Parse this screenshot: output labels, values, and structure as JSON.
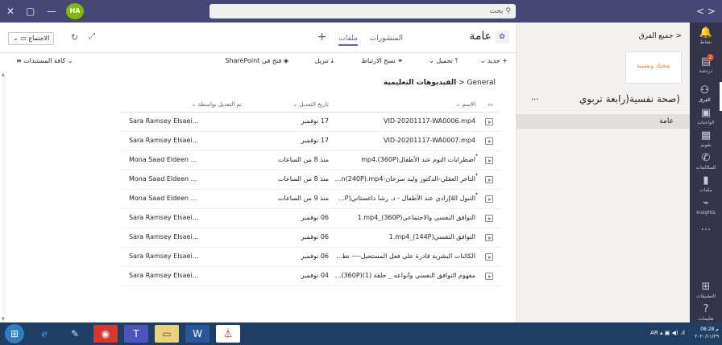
{
  "titlebar": {
    "avatar_initials": "HA",
    "search_placeholder": "بحث"
  },
  "appbar": {
    "items": [
      {
        "label": "نشاط",
        "icon": "bell-icon"
      },
      {
        "label": "دردشة",
        "icon": "chat-icon",
        "badge": "2"
      },
      {
        "label": "الفرق",
        "icon": "teams-icon"
      },
      {
        "label": "الواجبات",
        "icon": "assignments-icon"
      },
      {
        "label": "تقويم",
        "icon": "calendar-icon"
      },
      {
        "label": "المكالمات",
        "icon": "phone-icon"
      },
      {
        "label": "ملفات",
        "icon": "files-icon"
      },
      {
        "label": "Insights",
        "icon": "insights-icon"
      },
      {
        "label": "...",
        "icon": "more-icon"
      },
      {
        "label": "التطبيقات",
        "icon": "apps-icon"
      },
      {
        "label": "تعليمات",
        "icon": "help-icon"
      }
    ]
  },
  "teampanel": {
    "back_label": "جميع الفرق",
    "team_name": "(صحة نفسية(رابعة تربوي",
    "more": "...",
    "logo_text": "صحتك ونفسية",
    "channel": "عامة"
  },
  "channel_header": {
    "name": "عامة",
    "tabs": [
      "المنشورات",
      "ملفات"
    ],
    "active_tab": 1,
    "add_tab": "+",
    "meet_label": "الاجتماع"
  },
  "commandbar": {
    "new": "جديد",
    "upload": "تحميل",
    "copy_link": "نسخ الارتباط",
    "download": "تنزيل",
    "open_sharepoint": "فتح في SharePoint",
    "view": "كافة المستندات"
  },
  "breadcrumb": {
    "root": "General",
    "current": "الفيديوهات التعليمية"
  },
  "table": {
    "headers": {
      "name": "الاسم",
      "modified": "تاريخ التعديل",
      "modified_by": "تم التعديل بواسطة"
    },
    "rows": [
      {
        "name": "VID-20201117-WA0006.mp4",
        "modified": "17 نوفمبر",
        "by": "Sara Ramsey Elsaei...",
        "new": false
      },
      {
        "name": "VID-20201117-WA0007.mp4",
        "modified": "17 نوفمبر",
        "by": "Sara Ramsey Elsaei...",
        "new": false
      },
      {
        "name": "اضطرابات النوم عند الأطفال(360P).mp4",
        "modified": "منذ 8 من الساعات",
        "by": "Mona Saad Eldeen ...",
        "new": true
      },
      {
        "name": "التأخر العقلي-الدكتور وليد سرحان-dation(240P).mp4...",
        "modified": "منذ 8 من الساعات",
        "by": "Mona Saad Eldeen ...",
        "new": true
      },
      {
        "name": "التبول اللاإرادي عند الأطفال - د. رشا داغستاني(4P).mp4...",
        "modified": "منذ 9 من الساعات",
        "by": "Mona Saad Eldeen ...",
        "new": true
      },
      {
        "name": "التوافق النفسي والاجتماعي(360P)_1.mp4",
        "modified": "06 نوفمبر",
        "by": "Sara Ramsey Elsaei...",
        "new": false
      },
      {
        "name": "التوافق النفسي(144P)_1.mp4",
        "modified": "06 نوفمبر",
        "by": "Sara Ramsey Elsaei...",
        "new": false
      },
      {
        "name": "الكائنات البشرية قادرة على فعل المستحيل---- نظرية التك...",
        "modified": "06 نوفمبر",
        "by": "Sara Ramsey Elsaei...",
        "new": false
      },
      {
        "name": "مفهوم التوافق النفسي وأنواعه _ حلقة (1)(360P).mp4",
        "modified": "04 نوفمبر",
        "by": "Sara Ramsey Elsaei...",
        "new": false
      }
    ]
  },
  "taskbar": {
    "lang": "AR",
    "time": "08:28 م",
    "date": "٢٠٢٠/١١/٢٩"
  },
  "colors": {
    "titlebar": "#464775",
    "appbar": "#33344a",
    "accent": "#6264a7",
    "taskbar": "#1e3f63"
  }
}
